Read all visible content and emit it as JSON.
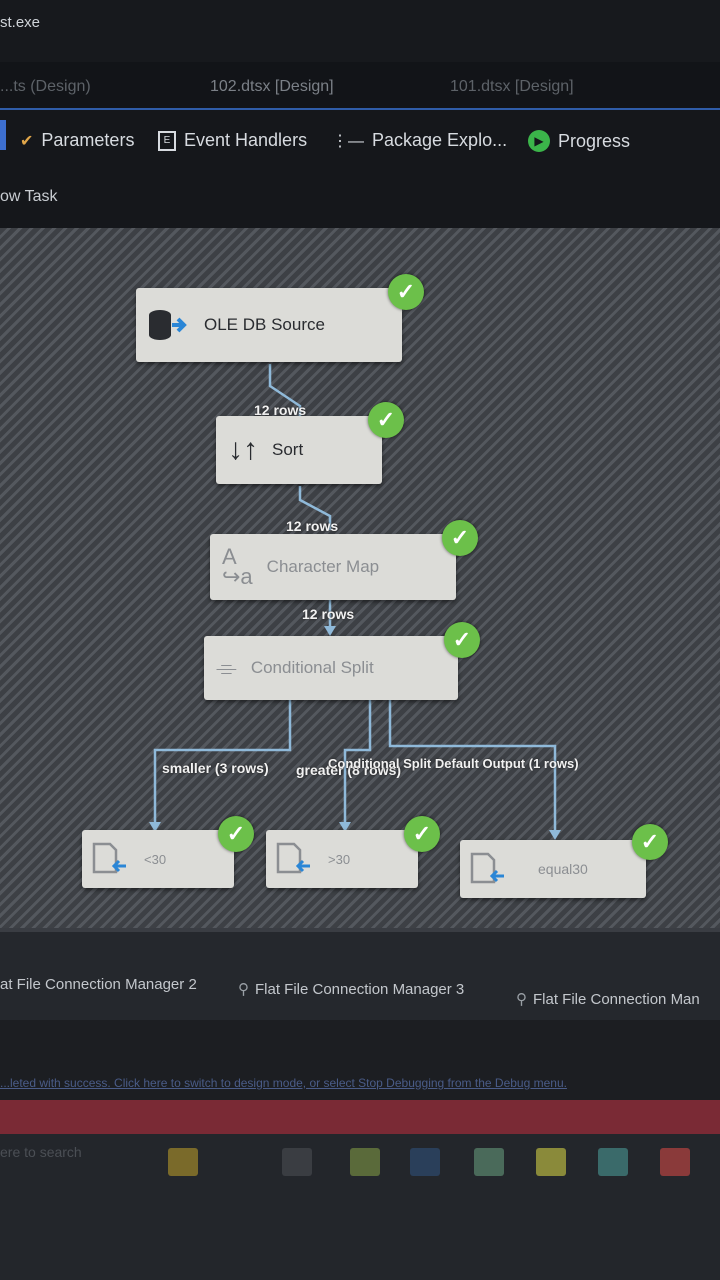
{
  "window": {
    "title": "st.exe"
  },
  "doc_tabs": [
    "...ts (Design)",
    "102.dtsx [Design]",
    "101.dtsx [Design]"
  ],
  "designer_tabs": {
    "parameters": "Parameters",
    "event_handlers": "Event Handlers",
    "package_explorer": "Package Explo...",
    "progress": "Progress"
  },
  "task_label": "ow Task",
  "nodes": {
    "source": "OLE DB Source",
    "sort": "Sort",
    "charmap": "Character Map",
    "split": "Conditional Split",
    "dest1": "<30",
    "dest2": ">30",
    "dest3": "equal30"
  },
  "paths": {
    "p1": "12 rows",
    "p2": "12 rows",
    "p3": "12 rows",
    "smaller": "smaller (3 rows)",
    "greater": "greater (8 rows)",
    "default": "Conditional Split Default Output (1 rows)"
  },
  "connections": [
    "at File Connection Manager 2",
    "Flat File Connection Manager 3",
    "Flat File Connection Man"
  ],
  "status_message": "...leted with success. Click here to switch to design mode, or select Stop Debugging from the Debug menu.",
  "taskbar": {
    "search_placeholder": "ere to search"
  },
  "colors": {
    "accent": "#3d6fcf",
    "success": "#6cc04a",
    "statusbar": "#7a2a35"
  }
}
